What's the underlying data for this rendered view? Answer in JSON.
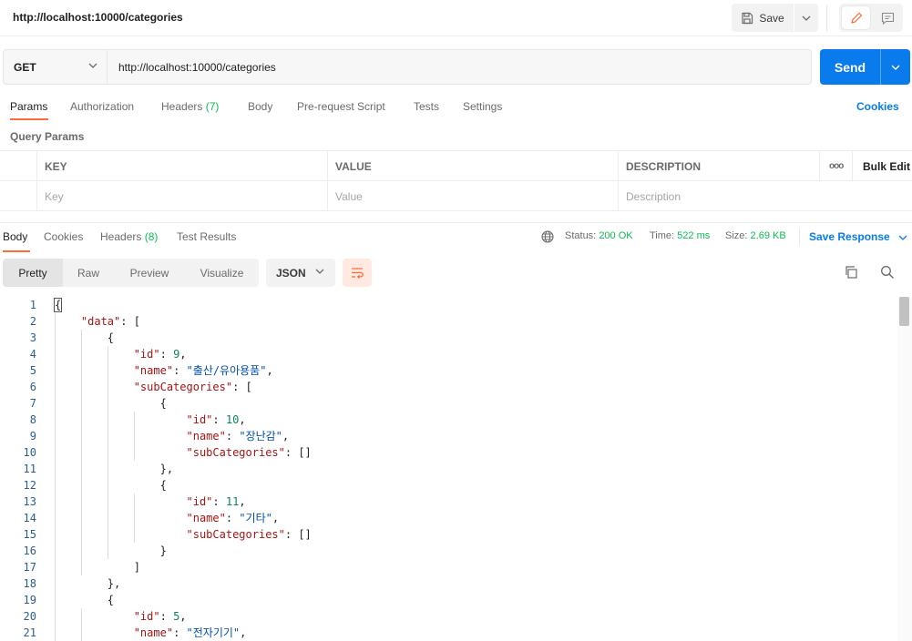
{
  "header": {
    "title": "http://localhost:10000/categories",
    "save_label": "Save"
  },
  "request": {
    "method": "GET",
    "url": "http://localhost:10000/categories",
    "send_label": "Send"
  },
  "request_tabs": {
    "params": "Params",
    "authorization": "Authorization",
    "headers": "Headers",
    "headers_count": "(7)",
    "body": "Body",
    "prerequest": "Pre-request Script",
    "tests": "Tests",
    "settings": "Settings",
    "cookies": "Cookies"
  },
  "query_params": {
    "label": "Query Params",
    "columns": {
      "key": "KEY",
      "value": "VALUE",
      "description": "DESCRIPTION"
    },
    "more": "ooo",
    "bulk_edit": "Bulk Edit",
    "placeholders": {
      "key": "Key",
      "value": "Value",
      "description": "Description"
    }
  },
  "response_tabs": {
    "body": "Body",
    "cookies": "Cookies",
    "headers": "Headers",
    "headers_count": "(8)",
    "test_results": "Test Results"
  },
  "response_meta": {
    "status_label": "Status:",
    "status_value": "200 OK",
    "time_label": "Time:",
    "time_value": "522 ms",
    "size_label": "Size:",
    "size_value": "2.69 KB",
    "save_response": "Save Response"
  },
  "view_modes": {
    "pretty": "Pretty",
    "raw": "Raw",
    "preview": "Preview",
    "visualize": "Visualize",
    "format": "JSON"
  },
  "colors": {
    "accent_blue": "#097bed",
    "tab_orange": "#ff6c37",
    "status_green": "#0cbb52"
  },
  "code_lines": [
    "{",
    "    \"data\": [",
    "        {",
    "            \"id\": 9,",
    "            \"name\": \"출산/유아용품\",",
    "            \"subCategories\": [",
    "                {",
    "                    \"id\": 10,",
    "                    \"name\": \"장난감\",",
    "                    \"subCategories\": []",
    "                },",
    "                {",
    "                    \"id\": 11,",
    "                    \"name\": \"기타\",",
    "                    \"subCategories\": []",
    "                }",
    "            ]",
    "        },",
    "        {",
    "            \"id\": 5,",
    "            \"name\": \"전자기기\","
  ]
}
